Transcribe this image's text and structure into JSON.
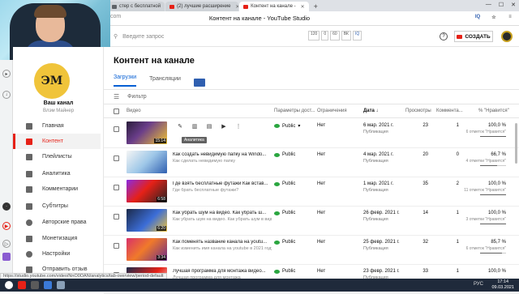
{
  "browser": {
    "tabs": [
      {
        "title": "стер с бесплатной"
      },
      {
        "title": "(2) лучшие расширение"
      },
      {
        "title": "Контент на канале -"
      }
    ],
    "new_tab": "+",
    "url_fragment": ".com",
    "page_title": "Контент на канале - YouTube Studio",
    "win_controls": [
      "—",
      "☐",
      "✕"
    ],
    "extensions": [
      "IQ",
      "☆",
      "≡"
    ],
    "status_url": "https://studio.youtube.com/video/NnO0OAN/analytics/tab-overview/period-default"
  },
  "studio": {
    "search_placeholder": "Введите запрос",
    "stats": [
      "120",
      "0",
      "60",
      "ВК",
      "IQ"
    ],
    "help": "?",
    "create_label": "СОЗДАТЬ"
  },
  "sidebar": {
    "logo_text": "ЭМ",
    "channel_name": "Ваш канал",
    "channel_sub": "Влэм Майнер",
    "items": [
      {
        "label": "Главная"
      },
      {
        "label": "Контент"
      },
      {
        "label": "Плейлисты"
      },
      {
        "label": "Аналитика"
      },
      {
        "label": "Комментарии"
      },
      {
        "label": "Субтитры"
      },
      {
        "label": "Авторские права"
      },
      {
        "label": "Монетизация"
      },
      {
        "label": "Настройки"
      },
      {
        "label": "Отправить отзыв"
      }
    ]
  },
  "main": {
    "title": "Контент на канале",
    "tabs": [
      "Загрузки",
      "Трансляции"
    ],
    "filter_label": "Фильтр",
    "columns": {
      "video": "Видео",
      "access": "Параметры дост...",
      "restrictions": "Ограничения",
      "date": "Дата ↓",
      "views": "Просмотры",
      "comments": "Коммента...",
      "likes": "% \"Нравится\""
    },
    "tooltip": "Аналитика",
    "rows": [
      {
        "title": "",
        "desc": "",
        "duration": "15:14",
        "access": "Public",
        "restr": "Нет",
        "date": "6 мар. 2021 г.",
        "date_sub": "Публикация",
        "views": "23",
        "comments": "1",
        "likes": "100,0 %",
        "likes_sub": "6 отметок \"Нравится\"",
        "ratio": 1.0,
        "hover": true
      },
      {
        "title": "Как создать невидимую папку на Windo...",
        "desc": "Как сделать невидимую папку",
        "duration": "",
        "access": "Public",
        "restr": "Нет",
        "date": "4 мар. 2021 г.",
        "date_sub": "Публикация",
        "views": "20",
        "comments": "0",
        "likes": "66,7 %",
        "likes_sub": "4 отметки \"Нравится\"",
        "ratio": 0.667,
        "hover": false
      },
      {
        "title": "Где взять бесплатные футажи Как встав...",
        "desc": "Где брать бесплатные футажи?",
        "duration": "6:58",
        "access": "Public",
        "restr": "Нет",
        "date": "1 мар. 2021 г.",
        "date_sub": "Публикация",
        "views": "35",
        "comments": "2",
        "likes": "100,0 %",
        "likes_sub": "11 отметок \"Нравится\"",
        "ratio": 1.0,
        "hover": false
      },
      {
        "title": "Как убрать шум на видео. Как убрать ш...",
        "desc": "Как убрать шум на видео. Как убрать шум в видео помехи из видео",
        "duration": "6:20",
        "access": "Public",
        "restr": "Нет",
        "date": "26 февр. 2021 г.",
        "date_sub": "Публикация",
        "views": "14",
        "comments": "1",
        "likes": "100,0 %",
        "likes_sub": "3 отметки \"Нравится\"",
        "ratio": 1.0,
        "hover": false
      },
      {
        "title": "Как поменять название канала на youtu...",
        "desc": "Как изменить имя канала на youtube в 2021 году?",
        "duration": "3:34",
        "access": "Public",
        "restr": "Нет",
        "date": "25 февр. 2021 г.",
        "date_sub": "Публикация",
        "views": "32",
        "comments": "1",
        "likes": "85,7 %",
        "likes_sub": "6 отметок \"Нравится\"",
        "ratio": 0.857,
        "hover": false
      },
      {
        "title": "Лучшая программа для монтажа видео...",
        "desc": "Лучшая программа для монтажа",
        "duration": "",
        "access": "Public",
        "restr": "Нет",
        "date": "23 февр. 2021 г.",
        "date_sub": "Публикация",
        "views": "33",
        "comments": "1",
        "likes": "100,0 %",
        "likes_sub": "",
        "ratio": 1.0,
        "hover": false
      }
    ]
  },
  "taskbar": {
    "tray": "РУС",
    "time": "17:14",
    "date": "09.03.2021"
  },
  "colors": {
    "accent_red": "#e62117",
    "link_blue": "#065fd4",
    "public_green": "#2ba640",
    "logo_yellow": "#f0c43a",
    "taskbar": "#1f2a3b"
  }
}
